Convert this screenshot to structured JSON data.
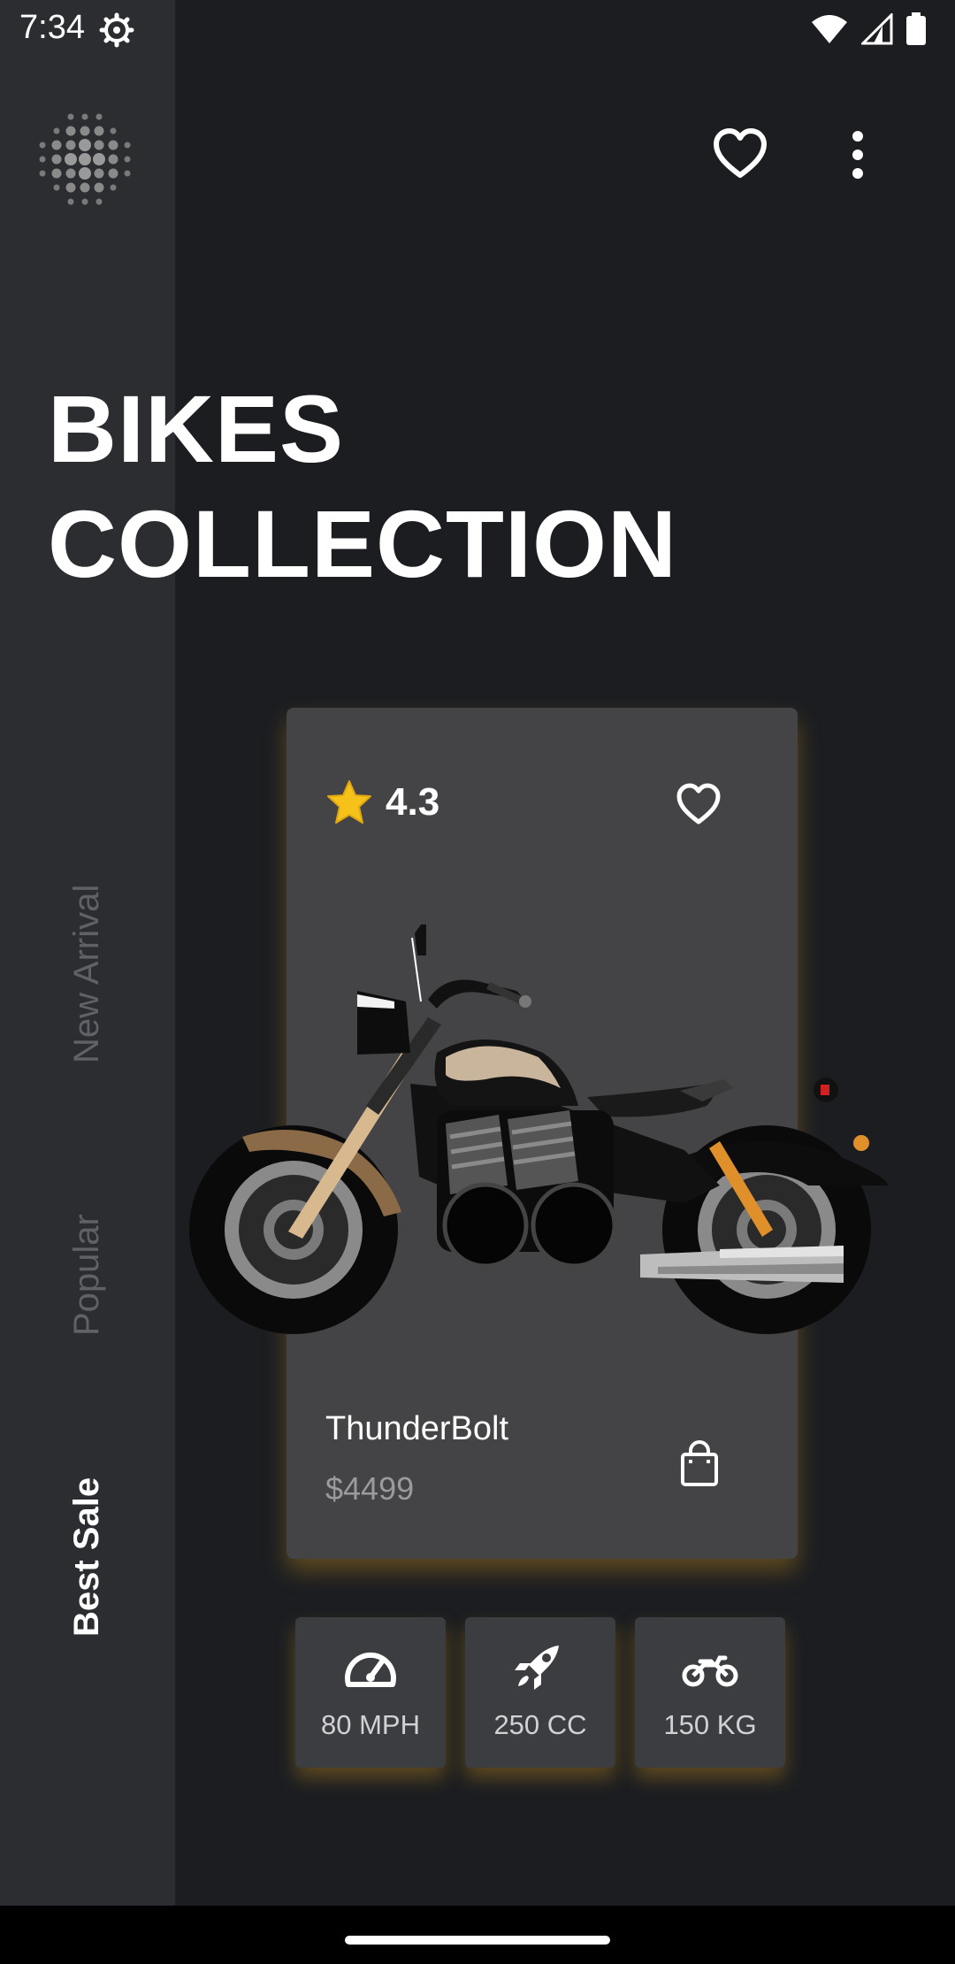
{
  "status_bar": {
    "time": "7:34"
  },
  "header": {
    "title_line1": "BIKES",
    "title_line2": "COLLECTION"
  },
  "sidebar": {
    "tabs": [
      {
        "label": "New Arrival",
        "active": false
      },
      {
        "label": "Popular",
        "active": false
      },
      {
        "label": "Best Sale",
        "active": true
      }
    ]
  },
  "product": {
    "rating": "4.3",
    "name": "ThunderBolt",
    "price": "$4499"
  },
  "specs": [
    {
      "icon": "speedometer-icon",
      "label": "80 MPH"
    },
    {
      "icon": "rocket-icon",
      "label": "250 CC"
    },
    {
      "icon": "motorcycle-icon",
      "label": "150 KG"
    }
  ],
  "colors": {
    "background": "#1b1d21",
    "sidebar": "#2b2d31",
    "card": "#444446",
    "accent_glow": "#d69a1e",
    "star": "#f6c21a"
  }
}
